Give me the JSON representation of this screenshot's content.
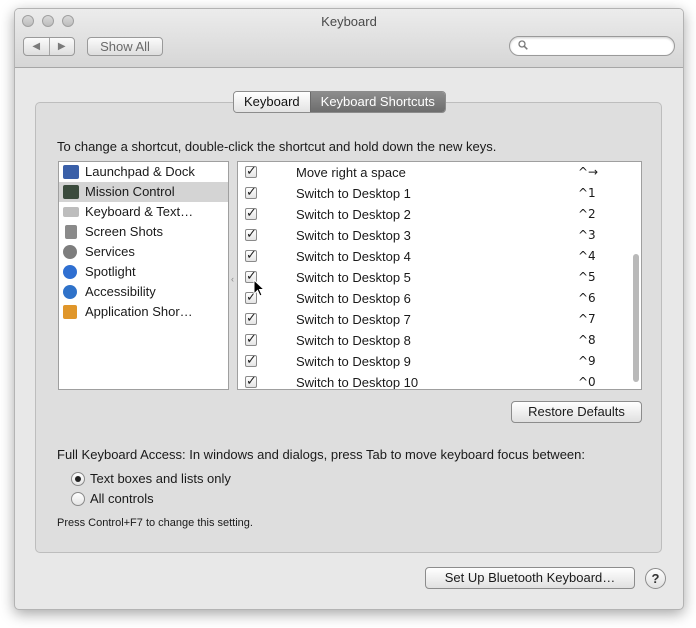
{
  "window": {
    "title": "Keyboard"
  },
  "toolbar": {
    "back_icon": "chevron-left",
    "forward_icon": "chevron-right",
    "show_all_label": "Show All",
    "search_placeholder": ""
  },
  "tabs": [
    {
      "label": "Keyboard",
      "active": false
    },
    {
      "label": "Keyboard Shortcuts",
      "active": true
    }
  ],
  "instruction": "To change a shortcut, double-click the shortcut and hold down the new keys.",
  "categories": [
    {
      "label": "Launchpad & Dock",
      "icon": "launchpad-icon",
      "color": "#3a5fa8",
      "selected": false
    },
    {
      "label": "Mission Control",
      "icon": "mission-control-icon",
      "color": "#3b4b3d",
      "selected": true
    },
    {
      "label": "Keyboard & Text…",
      "icon": "keyboard-icon",
      "color": "#bdbdbd",
      "selected": false
    },
    {
      "label": "Screen Shots",
      "icon": "screenshot-icon",
      "color": "#8a8a8a",
      "selected": false
    },
    {
      "label": "Services",
      "icon": "gear-icon",
      "color": "#7d7d7d",
      "selected": false
    },
    {
      "label": "Spotlight",
      "icon": "spotlight-icon",
      "color": "#2f6fd1",
      "selected": false
    },
    {
      "label": "Accessibility",
      "icon": "accessibility-icon",
      "color": "#2f72c9",
      "selected": false
    },
    {
      "label": "Application Shor…",
      "icon": "app-shortcuts-icon",
      "color": "#e0962a",
      "selected": false
    }
  ],
  "shortcuts": [
    {
      "name": "Move right a space",
      "key": "^→",
      "checked": true
    },
    {
      "name": "Switch to Desktop 1",
      "key": "^1",
      "checked": true
    },
    {
      "name": "Switch to Desktop 2",
      "key": "^2",
      "checked": true
    },
    {
      "name": "Switch to Desktop 3",
      "key": "^3",
      "checked": true
    },
    {
      "name": "Switch to Desktop 4",
      "key": "^4",
      "checked": true
    },
    {
      "name": "Switch to Desktop 5",
      "key": "^5",
      "checked": true
    },
    {
      "name": "Switch to Desktop 6",
      "key": "^6",
      "checked": true
    },
    {
      "name": "Switch to Desktop 7",
      "key": "^7",
      "checked": true
    },
    {
      "name": "Switch to Desktop 8",
      "key": "^8",
      "checked": true
    },
    {
      "name": "Switch to Desktop 9",
      "key": "^9",
      "checked": true
    },
    {
      "name": "Switch to Desktop 10",
      "key": "^0",
      "checked": true
    }
  ],
  "restore_defaults_label": "Restore Defaults",
  "full_keyboard_access": {
    "label": "Full Keyboard Access: In windows and dialogs, press Tab to move keyboard focus between:",
    "options": [
      {
        "label": "Text boxes and lists only",
        "selected": true
      },
      {
        "label": "All controls",
        "selected": false
      }
    ],
    "note": "Press Control+F7 to change this setting."
  },
  "bluetooth_button_label": "Set Up Bluetooth Keyboard…",
  "help_label": "?"
}
